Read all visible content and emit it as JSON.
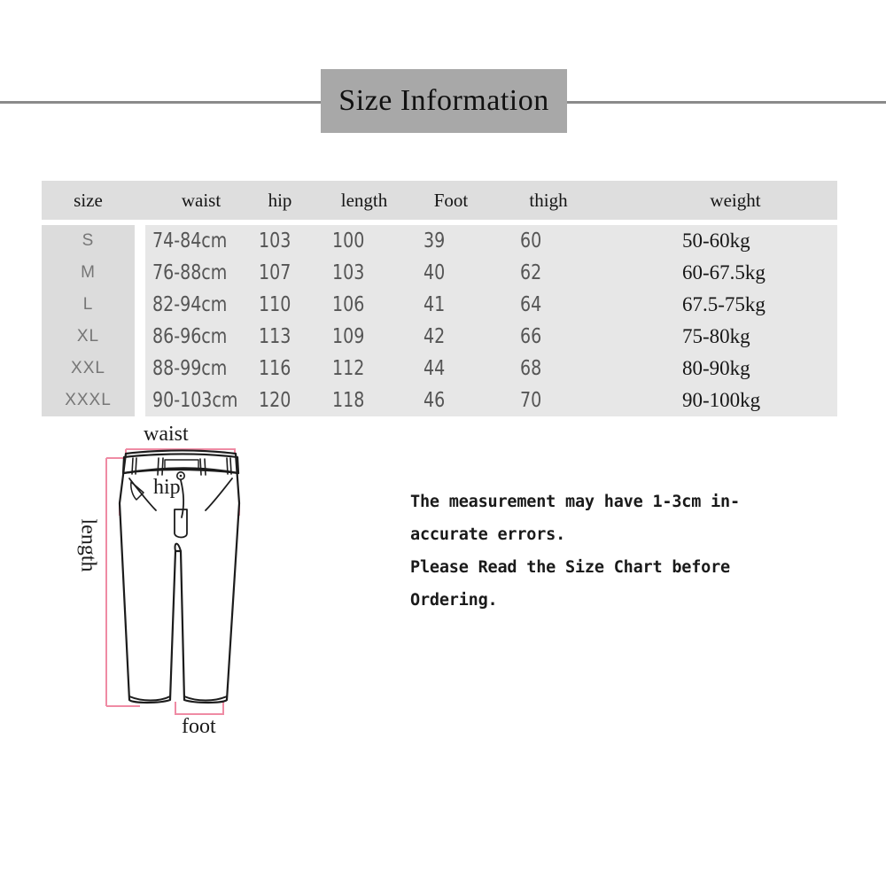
{
  "title": {
    "text": "Size Information"
  },
  "table": {
    "headers": [
      "size",
      "waist",
      "hip",
      "length",
      "Foot",
      "thigh",
      "weight"
    ],
    "rows": [
      {
        "size": "S",
        "waist": "74-84cm",
        "hip": "103",
        "length": "100",
        "foot": "39",
        "thigh": "60",
        "weight": "50-60kg"
      },
      {
        "size": "M",
        "waist": "76-88cm",
        "hip": "107",
        "length": "103",
        "foot": "40",
        "thigh": "62",
        "weight": "60-67.5kg"
      },
      {
        "size": "L",
        "waist": "82-94cm",
        "hip": "110",
        "length": "106",
        "foot": "41",
        "thigh": "64",
        "weight": "67.5-75kg"
      },
      {
        "size": "XL",
        "waist": "86-96cm",
        "hip": "113",
        "length": "109",
        "foot": "42",
        "thigh": "66",
        "weight": "75-80kg"
      },
      {
        "size": "XXL",
        "waist": "88-99cm",
        "hip": "116",
        "length": "112",
        "foot": "44",
        "thigh": "68",
        "weight": "80-90kg"
      },
      {
        "size": "XXXL",
        "waist": "90-103cm",
        "hip": "120",
        "length": "118",
        "foot": "46",
        "thigh": "70",
        "weight": "90-100kg"
      }
    ]
  },
  "diagram": {
    "labels": {
      "waist": "waist",
      "hip": "hip",
      "length": "length",
      "foot": "foot"
    }
  },
  "note": {
    "lines": [
      "The measurement may have 1-3cm in-",
      "accurate errors.",
      "Please Read the Size Chart before",
      "Ordering."
    ]
  },
  "colors": {
    "title_box": "#a8a8a8",
    "rule": "#8a8a8a",
    "header_band": "#dedede",
    "size_band": "#dcdcdc",
    "data_band": "#e7e7e7",
    "guide_pink": "#ef8ba4",
    "outline": "#1c1c1c",
    "background": "#ffffff"
  }
}
